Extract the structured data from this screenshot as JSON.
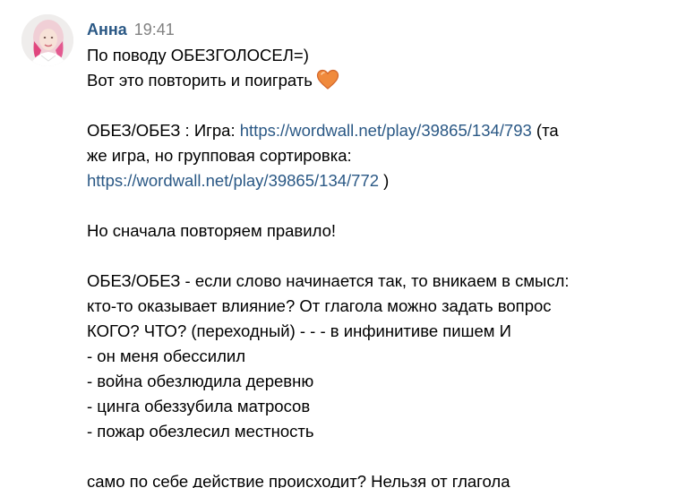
{
  "message": {
    "author": "Анна",
    "time": "19:41",
    "text": {
      "line1": "По поводу ОБЕЗГОЛОСЕЛ=)",
      "line2": "Вот это повторить и поиграть",
      "game_prefix": "ОБЕЗ/ОБЕЗ : Игра: ",
      "game_link": "https://wordwall.net/play/39865/134/793",
      "game_suffix": " (та",
      "game_cont": "же игра, но групповая сортировка:",
      "group_link": "https://wordwall.net/play/39865/134/772",
      "group_suffix": " )",
      "rule_intro": "Но сначала повторяем правило!",
      "rule1": "ОБЕЗ/ОБЕЗ - если слово начинается так, то вникаем в смысл:",
      "rule2": "кто-то оказывает влияние? От глагола можно задать вопрос",
      "rule3": "КОГО? ЧТО? (переходный) - - - в инфинитиве пишем И",
      "ex1": "- он меня обессилил",
      "ex2": "- война обезлюдила деревню",
      "ex3": "- цинга обеззубила матросов",
      "ex4": "- пожар обезлесил местность",
      "rule4": "само по себе действие происходит? Нельзя от глагола"
    },
    "emoji": "heart-emoji"
  },
  "colors": {
    "link": "#2a5885",
    "time": "#828282",
    "heart": "#f08a3c"
  }
}
